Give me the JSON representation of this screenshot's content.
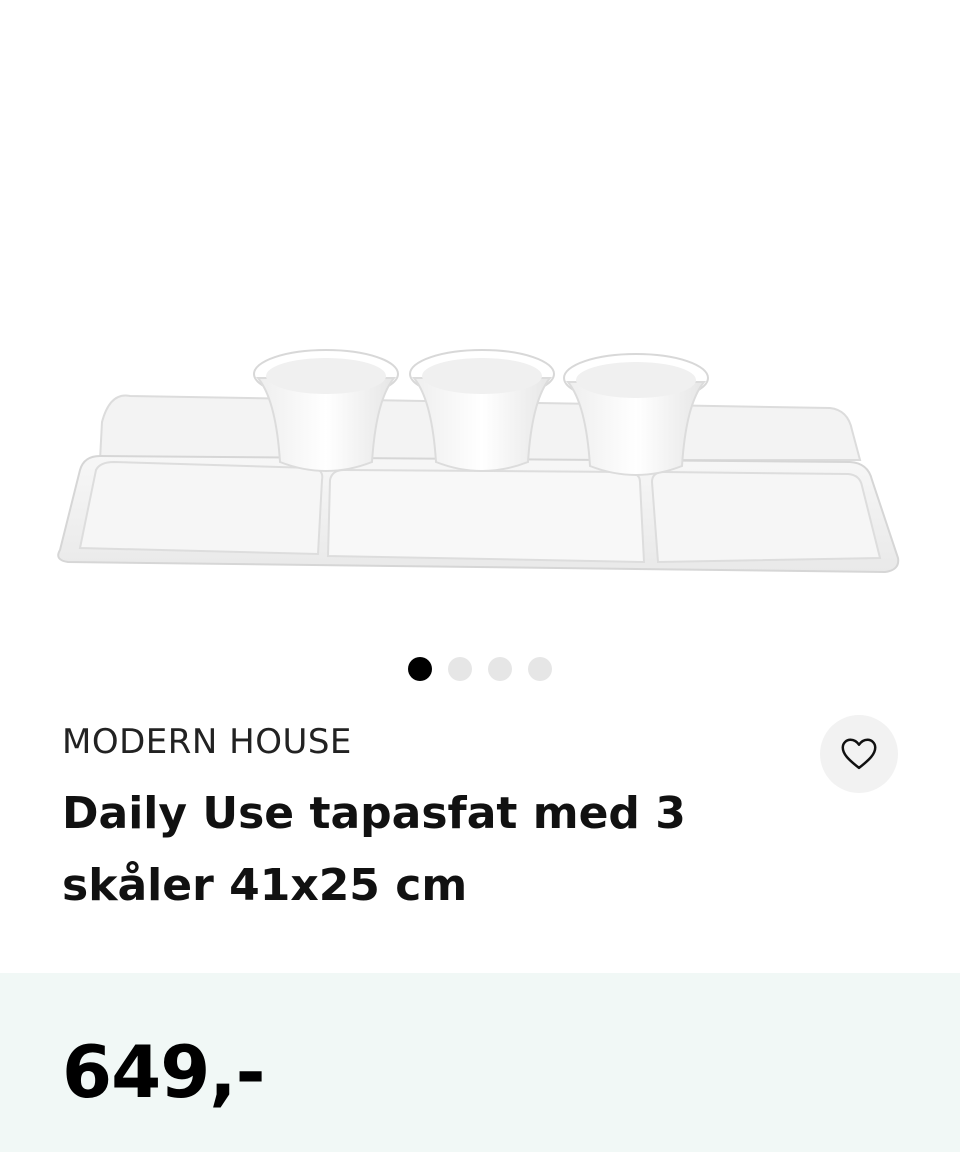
{
  "gallery": {
    "image_name": "tapas-platter-image",
    "slide_count": 4,
    "active_slide": 1
  },
  "product": {
    "brand": "MODERN HOUSE",
    "title": "Daily Use tapasfat med 3 skåler 41x25 cm",
    "price": "649,-"
  },
  "actions": {
    "favorite_icon": "heart-icon"
  },
  "colors": {
    "price_band": "#f1f8f6",
    "dot_active": "#000000",
    "dot_inactive": "#e6e6e6"
  }
}
